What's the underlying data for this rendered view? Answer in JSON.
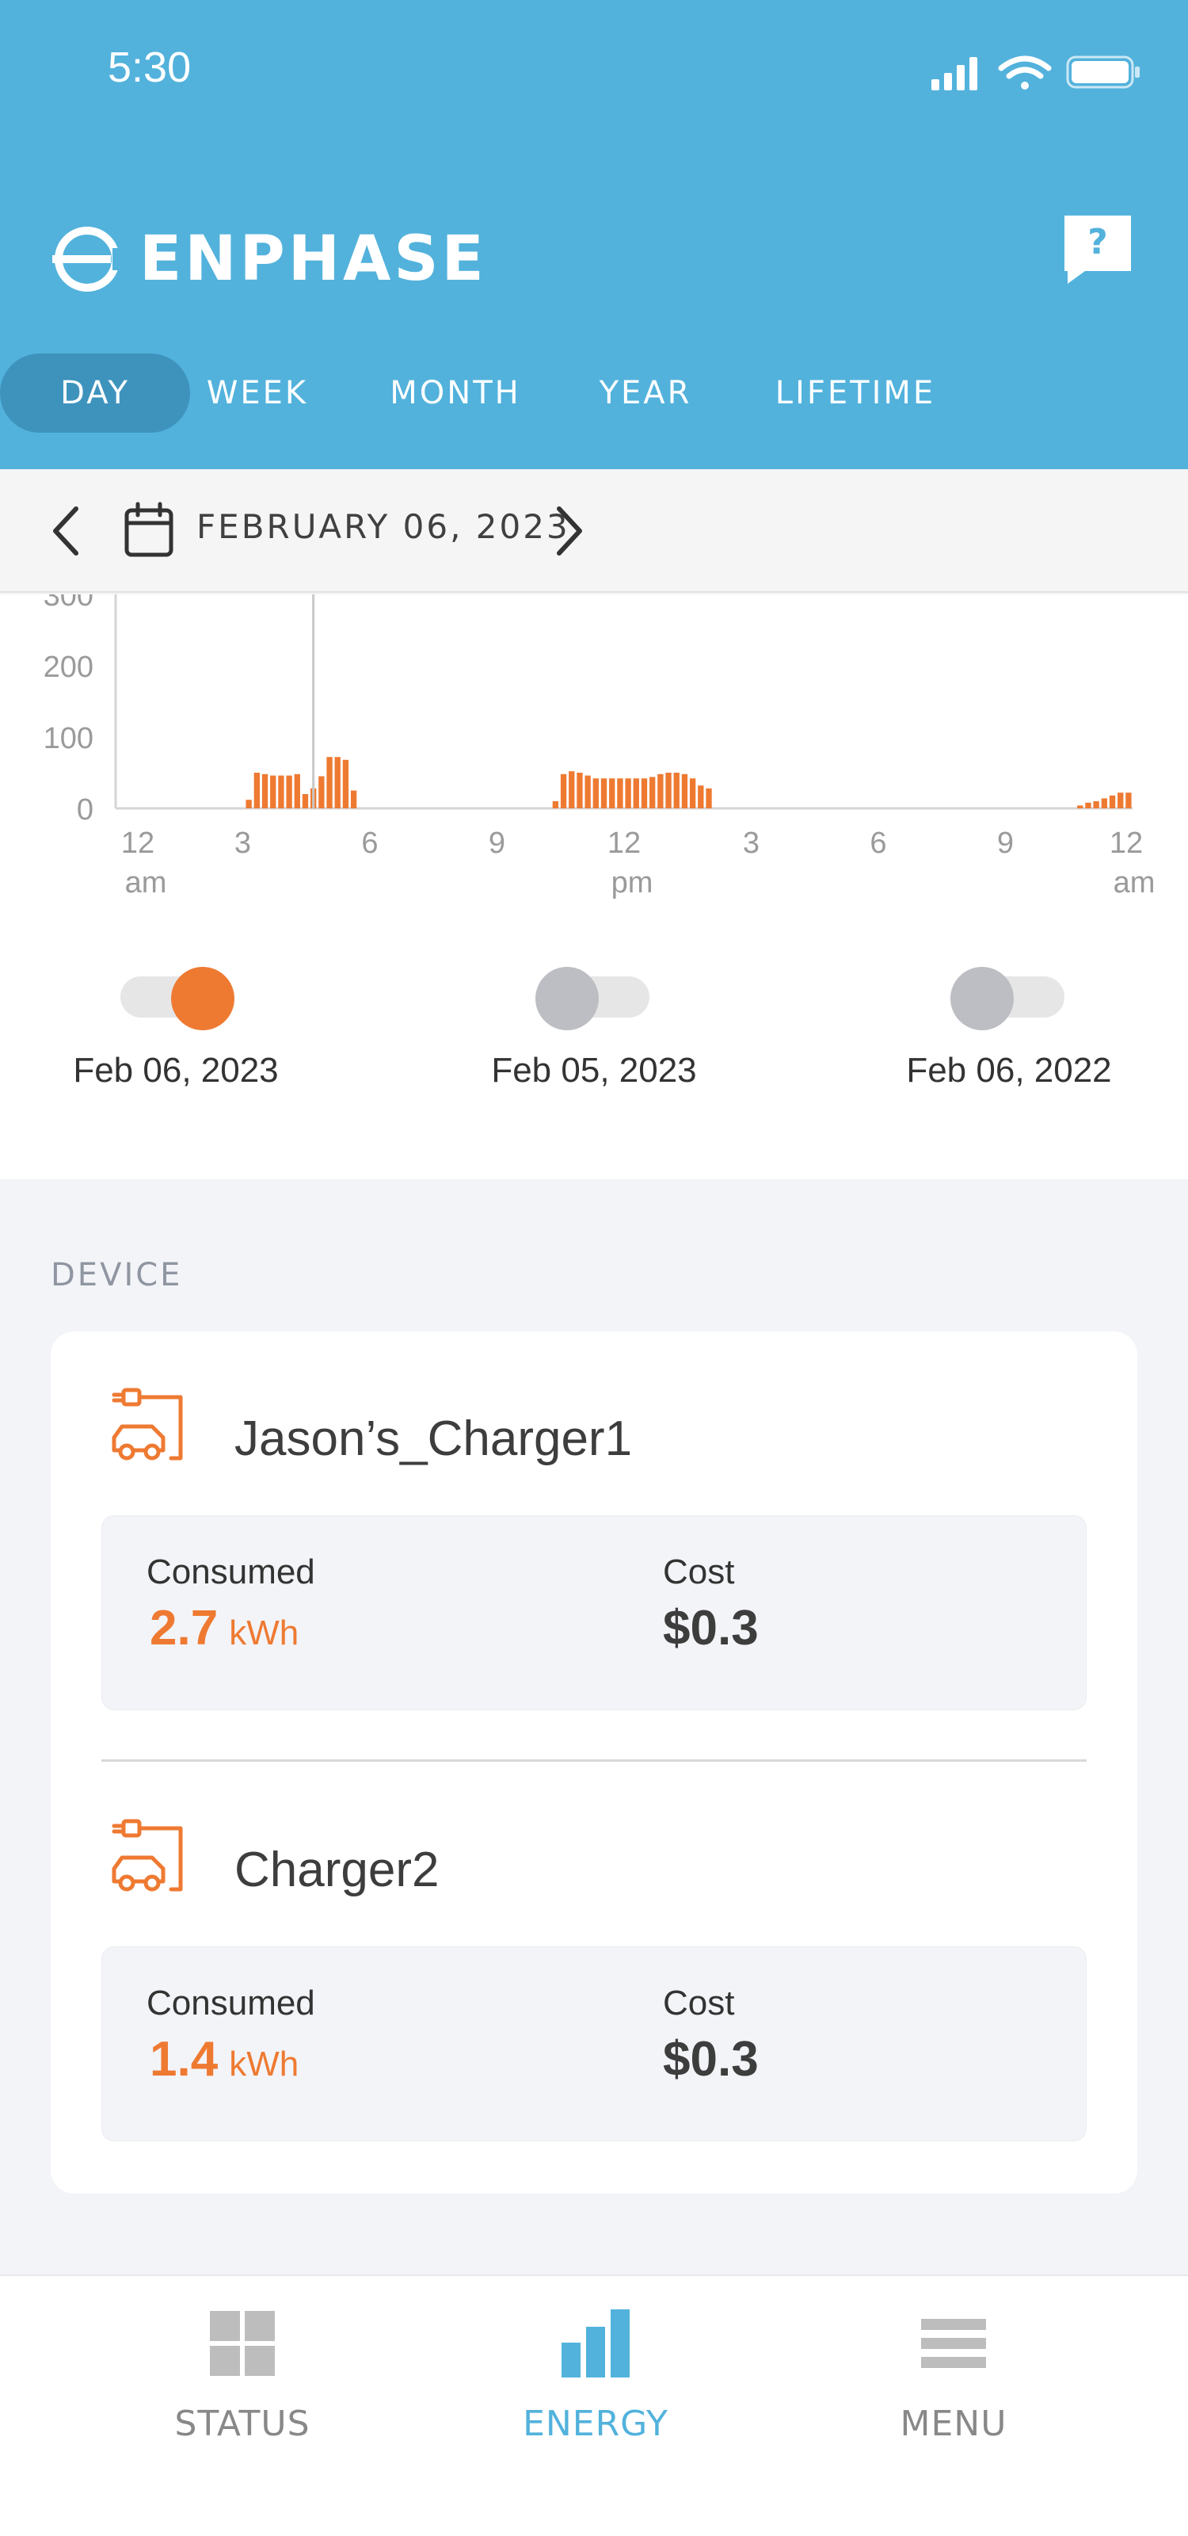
{
  "status_bar": {
    "time": "5:30"
  },
  "header": {
    "brand": "ENPHASE",
    "tabs": [
      {
        "label": "DAY",
        "active": true
      },
      {
        "label": "WEEK",
        "active": false
      },
      {
        "label": "MONTH",
        "active": false
      },
      {
        "label": "YEAR",
        "active": false
      },
      {
        "label": "LIFETIME",
        "active": false
      }
    ],
    "help_icon": "question-icon"
  },
  "date_nav": {
    "date": "FEBRUARY 06, 2023"
  },
  "chart_data": {
    "type": "bar",
    "ylim": [
      0,
      300
    ],
    "yticks": [
      "300",
      "200",
      "100",
      "0"
    ],
    "xticks": [
      {
        "top": "12",
        "bottom": "am"
      },
      {
        "top": "3",
        "bottom": ""
      },
      {
        "top": "6",
        "bottom": ""
      },
      {
        "top": "9",
        "bottom": ""
      },
      {
        "top": "12",
        "bottom": "pm"
      },
      {
        "top": "3",
        "bottom": ""
      },
      {
        "top": "6",
        "bottom": ""
      },
      {
        "top": "9",
        "bottom": ""
      },
      {
        "top": "12",
        "bottom": "am"
      }
    ],
    "interval_minutes": 15,
    "values": [
      0,
      0,
      0,
      0,
      0,
      0,
      0,
      0,
      0,
      0,
      0,
      0,
      0,
      0,
      0,
      0,
      12,
      50,
      48,
      46,
      46,
      46,
      48,
      20,
      28,
      45,
      72,
      72,
      68,
      25,
      0,
      0,
      0,
      0,
      0,
      0,
      0,
      0,
      0,
      0,
      0,
      0,
      0,
      0,
      0,
      0,
      0,
      0,
      0,
      0,
      0,
      0,
      0,
      0,
      10,
      48,
      52,
      50,
      46,
      42,
      42,
      42,
      42,
      42,
      42,
      42,
      44,
      48,
      50,
      50,
      48,
      42,
      32,
      28,
      0,
      0,
      0,
      0,
      0,
      0,
      0,
      0,
      0,
      0,
      0,
      0,
      0,
      0,
      0,
      0,
      0,
      0,
      0,
      0,
      0,
      0,
      0,
      0,
      0,
      0,
      0,
      0,
      0,
      0,
      0,
      0,
      0,
      0,
      0,
      0,
      0,
      0,
      0,
      0,
      0,
      0,
      0,
      0,
      0,
      4,
      8,
      10,
      14,
      18,
      22,
      22
    ],
    "cursor_index": 24,
    "color": "#ee7a32"
  },
  "comparisons": [
    {
      "label": "Feb 06, 2023",
      "on": true,
      "color": "#ee7a32"
    },
    {
      "label": "Feb 05, 2023",
      "on": false,
      "color": "#bcbec3"
    },
    {
      "label": "Feb 06, 2022",
      "on": false,
      "color": "#bcbec3"
    }
  ],
  "device_section": {
    "title": "DEVICE",
    "devices": [
      {
        "name": "Jason’s_Charger1",
        "icon": "ev-charger-icon",
        "consumed_label": "Consumed",
        "consumed_value": "2.7",
        "consumed_unit": "kWh",
        "cost_label": "Cost",
        "cost_value": "$0.3"
      },
      {
        "name": "Charger2",
        "icon": "ev-charger-icon",
        "consumed_label": "Consumed",
        "consumed_value": "1.4",
        "consumed_unit": "kWh",
        "cost_label": "Cost",
        "cost_value": "$0.3"
      }
    ]
  },
  "bottom_nav": [
    {
      "label": "STATUS",
      "icon": "grid-icon",
      "active": false
    },
    {
      "label": "ENERGY",
      "icon": "bar-chart-icon",
      "active": true
    },
    {
      "label": "MENU",
      "icon": "menu-icon",
      "active": false
    }
  ],
  "colors": {
    "header": "#52b2dc",
    "active_tab": "#3e93bd",
    "accent": "#ee7a32",
    "nav_active": "#52b2dc",
    "nav_inactive": "#888888"
  }
}
